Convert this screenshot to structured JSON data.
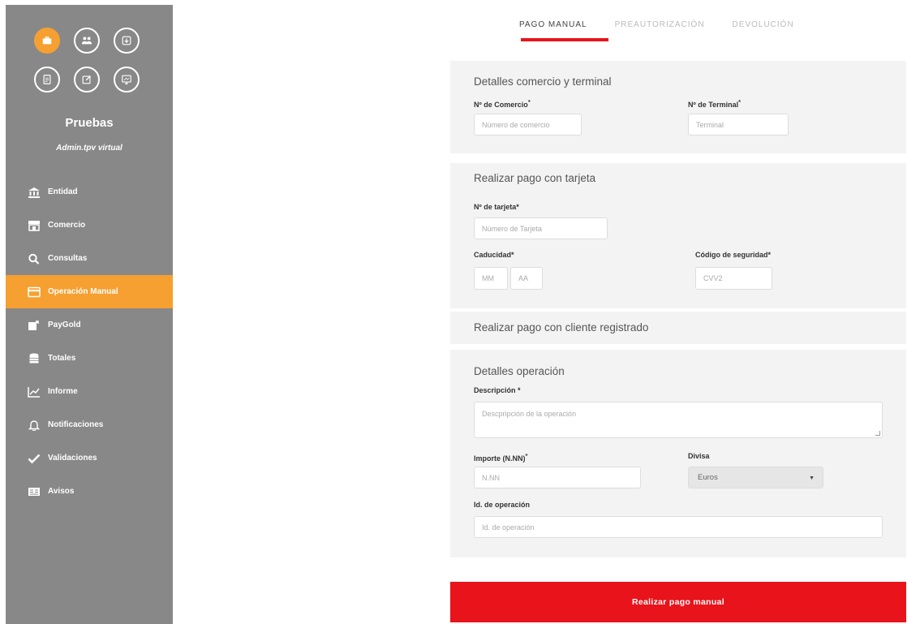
{
  "sidebar": {
    "app_icons": [
      {
        "icon": "briefcase-icon",
        "active": true
      },
      {
        "icon": "users-icon",
        "active": false
      },
      {
        "icon": "download-icon",
        "active": false
      },
      {
        "icon": "document-icon",
        "active": false
      },
      {
        "icon": "edit-icon",
        "active": false
      },
      {
        "icon": "monitor-icon",
        "active": false
      }
    ],
    "title": "Pruebas",
    "subtitle": "Admin.tpv virtual",
    "items": [
      {
        "label": "Entidad",
        "icon": "bank-icon"
      },
      {
        "label": "Comercio",
        "icon": "store-icon"
      },
      {
        "label": "Consultas",
        "icon": "search-icon"
      },
      {
        "label": "Operación Manual",
        "icon": "card-icon",
        "active": true
      },
      {
        "label": "PayGold",
        "icon": "share-icon"
      },
      {
        "label": "Totales",
        "icon": "database-icon"
      },
      {
        "label": "Informe",
        "icon": "chart-icon"
      },
      {
        "label": "Notificaciones",
        "icon": "bell-icon"
      },
      {
        "label": "Validaciones",
        "icon": "check-icon"
      },
      {
        "label": "Avisos",
        "icon": "notice-icon"
      }
    ]
  },
  "tabs": [
    {
      "label": "PAGO MANUAL",
      "active": true
    },
    {
      "label": "PREAUTORIZACIÓN",
      "active": false
    },
    {
      "label": "DEVOLUCIÓN",
      "active": false
    }
  ],
  "merchant": {
    "title": "Detalles comercio y terminal",
    "commerce_label": "Nº de Comercio",
    "commerce_placeholder": "Número de comercio",
    "terminal_label": "Nº de Terminal",
    "terminal_placeholder": "Terminal"
  },
  "card": {
    "title": "Realizar pago con tarjeta",
    "number_label": "Nº de tarjeta*",
    "number_placeholder": "Número de Tarjeta",
    "expiry_label": "Caducidad*",
    "month_placeholder": "MM",
    "year_placeholder": "AA",
    "cvv_label": "Código de seguridad*",
    "cvv_placeholder": "CVV2"
  },
  "registered": {
    "title": "Realizar pago con cliente registrado"
  },
  "operation": {
    "title": "Detalles operación",
    "description_label": "Descripción *",
    "description_placeholder": "Descpripción de la operación",
    "amount_label": "Importe (N.NN)",
    "amount_placeholder": "N.NN",
    "currency_label": "Divisa",
    "currency_value": "Euros",
    "opid_label": "Id. de operación",
    "opid_placeholder": "Id. de operación"
  },
  "submit_label": "Realizar pago manual",
  "colors": {
    "accent_orange": "#f5a030",
    "accent_red": "#e8131b",
    "sidebar_gray": "#888888"
  }
}
